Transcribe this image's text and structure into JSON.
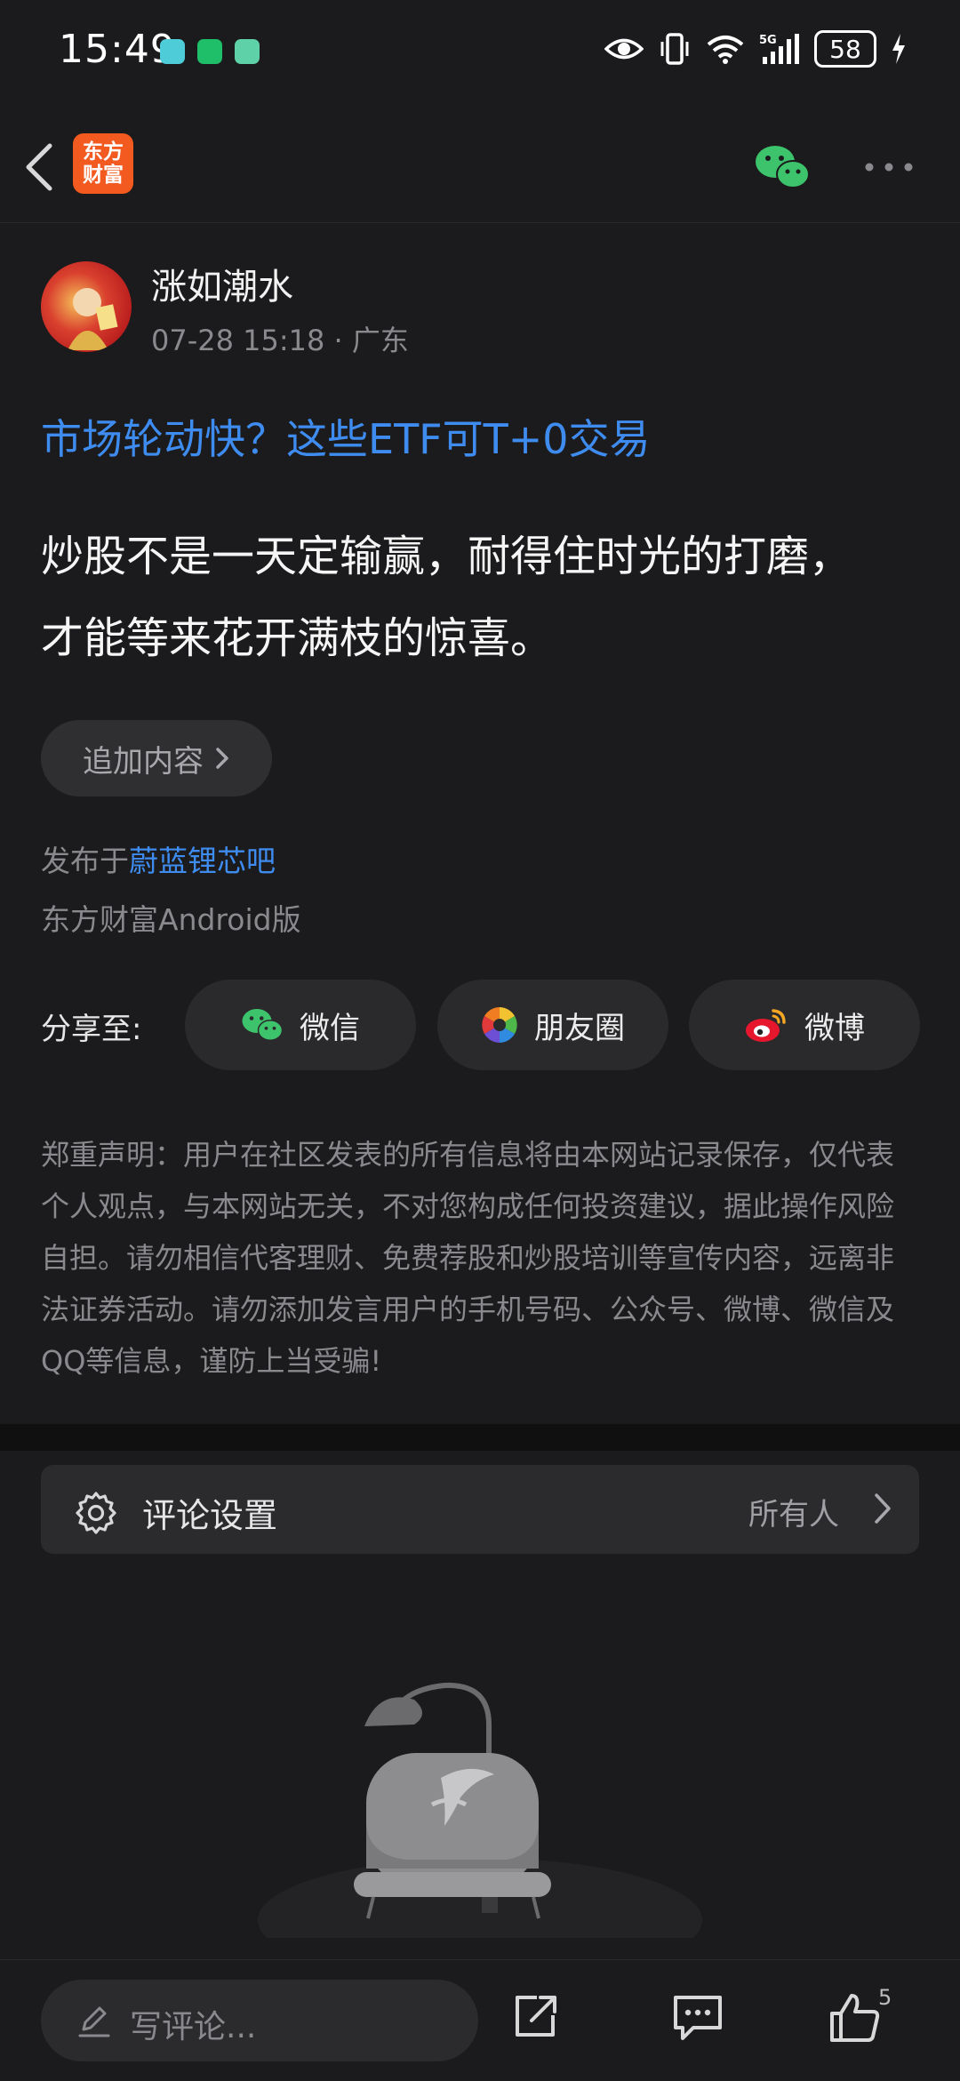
{
  "status": {
    "time": "15:49",
    "battery": "58"
  },
  "header": {
    "logo_text": [
      "东方",
      "财富"
    ]
  },
  "post": {
    "author_name": "涨如潮水",
    "date": "07-28 15:18",
    "location": "广东",
    "link_title": "市场轮动快？这些ETF可T+0交易",
    "body_lines": [
      "炒股不是一天定输赢，耐得住时光的打磨，",
      "才能等来花开满枝的惊喜。"
    ],
    "append_label": "追加内容",
    "published_prefix": "发布于",
    "published_bar": "蔚蓝锂芯吧",
    "client": "东方财富Android版"
  },
  "share": {
    "label": "分享至:",
    "wechat": "微信",
    "moments": "朋友圈",
    "weibo": "微博"
  },
  "disclaimer": "郑重声明：用户在社区发表的所有信息将由本网站记录保存，仅代表个人观点，与本网站无关，不对您构成任何投资建议，据此操作风险自担。请勿相信代客理财、免费荐股和炒股培训等宣传内容，远离非法证券活动。请勿添加发言用户的手机号码、公众号、微博、微信及QQ等信息，谨防上当受骗!",
  "comment_settings": {
    "label": "评论设置",
    "value": "所有人"
  },
  "bottom_bar": {
    "placeholder": "写评论...",
    "like_count": "5"
  },
  "colors": {
    "background": "#1b1b1d",
    "link_blue": "#3f8cf0",
    "brand_orange": "#f25a1f",
    "wechat_green": "#3cc36b"
  }
}
